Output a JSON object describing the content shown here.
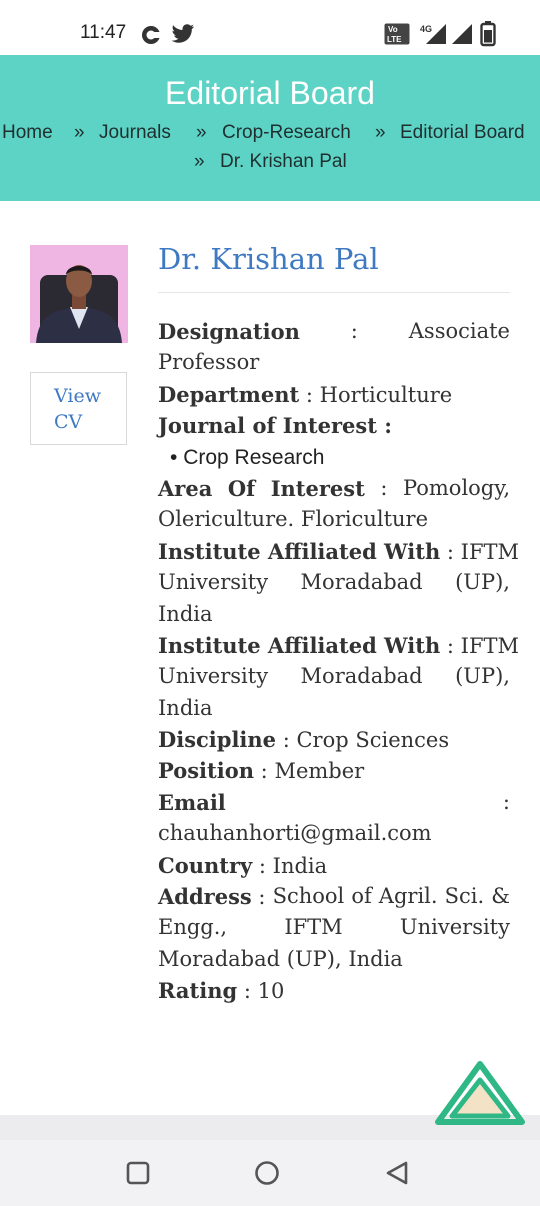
{
  "status_bar": {
    "time": "11:47",
    "icons": [
      "c-app-icon",
      "twitter-icon",
      "volte-icon",
      "signal-4g-icon",
      "signal-icon",
      "battery-icon"
    ],
    "volte_label": "VoLTE",
    "network_label": "4G"
  },
  "header": {
    "title": "Editorial Board",
    "background": "#5dd3c6",
    "breadcrumb": [
      "Home",
      "Journals",
      "Crop-Research",
      "Editorial Board",
      "Dr. Krishan Pal"
    ],
    "separator": "»"
  },
  "profile": {
    "name": "Dr. Krishan Pal",
    "view_cv_label": "View CV",
    "link_color": "#3e79c2",
    "designation_label": "Designation",
    "designation_value": "Associate Professor",
    "department_label": "Department",
    "department_value": "Horticulture",
    "journal_label": "Journal of Interest :",
    "journals": [
      "Crop Research"
    ],
    "area_label": "Area Of Interest",
    "area_value": "Pomology, Olericulture. Floriculture",
    "institute_label": "Institute Affiliated With",
    "institute_value": "IFTM University Moradabad (UP), India",
    "institute2_label": "Institute Affiliated With",
    "institute2_value": "IFTM University Moradabad (UP), India",
    "discipline_label": "Discipline",
    "discipline_value": "Crop Sciences",
    "position_label": "Position",
    "position_value": "Member",
    "email_label": "Email",
    "email_value": "chauhanhorti@gmail.com",
    "country_label": "Country",
    "country_value": "India",
    "address_label": "Address",
    "address_value": "School of Agril. Sci. & Engg., IFTM University Moradabad (UP), India",
    "rating_label": "Rating",
    "rating_value": "10"
  },
  "nav_bar": {
    "buttons": [
      "recents-square-icon",
      "home-circle-icon",
      "back-triangle-icon"
    ]
  }
}
